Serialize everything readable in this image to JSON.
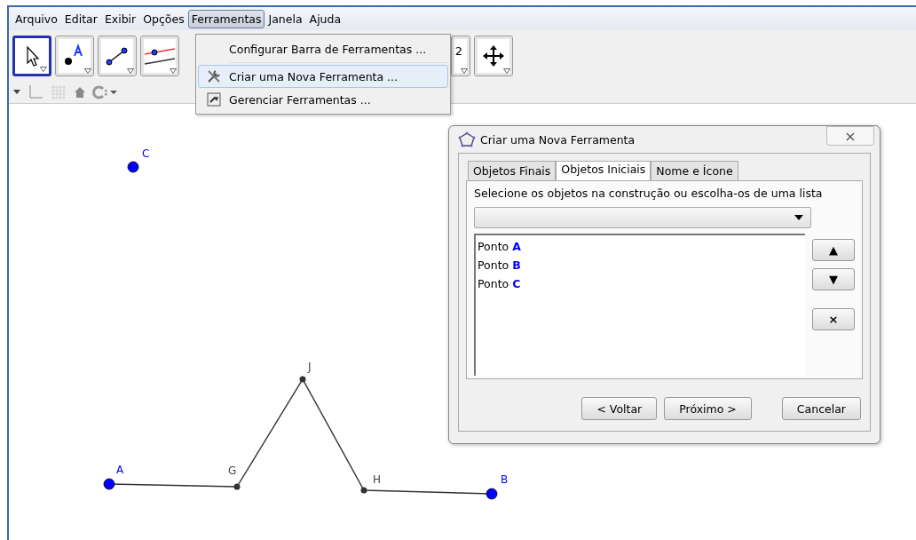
{
  "menu_bar": [
    {
      "label": "Arquivo",
      "selected": false
    },
    {
      "label": "Editar",
      "selected": false
    },
    {
      "label": "Exibir",
      "selected": false
    },
    {
      "label": "Opções",
      "selected": false
    },
    {
      "label": "Ferramentas",
      "selected": true
    },
    {
      "label": "Janela",
      "selected": false
    },
    {
      "label": "Ajuda",
      "selected": false
    }
  ],
  "toolbar": [
    {
      "kind": "select",
      "selected": true
    },
    {
      "kind": "point",
      "selected": false
    },
    {
      "kind": "segment",
      "selected": false
    },
    {
      "kind": "parallel",
      "selected": false
    },
    {
      "kind": "slider",
      "label": "2",
      "selected": false
    },
    {
      "kind": "move",
      "selected": false
    }
  ],
  "dropdown_menu": [
    {
      "kind": "plain",
      "label": "Configurar Barra de Ferramentas ...",
      "selected": false
    },
    {
      "kind": "create",
      "label": "Criar uma Nova Ferramenta ...",
      "selected": true
    },
    {
      "kind": "manage",
      "label": "Gerenciar Ferramentas ...",
      "selected": false
    }
  ],
  "canvas": {
    "points": [
      {
        "label": "C",
        "kind": "free"
      },
      {
        "label": "A",
        "kind": "free"
      },
      {
        "label": "G",
        "kind": "dependent"
      },
      {
        "label": "J",
        "kind": "dependent"
      },
      {
        "label": "H",
        "kind": "dependent"
      },
      {
        "label": "B",
        "kind": "free"
      }
    ]
  },
  "dialog": {
    "title": "Criar uma Nova Ferramenta",
    "close": "×",
    "tabs": [
      {
        "label": "Objetos Finais",
        "selected": false
      },
      {
        "label": "Objetos Iniciais",
        "selected": true
      },
      {
        "label": "Nome e Ícone",
        "selected": false
      }
    ],
    "instruction": "Selecione os objetos na construção ou escolha-os de uma lista",
    "objects": [
      {
        "type": "Ponto",
        "name": "A"
      },
      {
        "type": "Ponto",
        "name": "B"
      },
      {
        "type": "Ponto",
        "name": "C"
      }
    ],
    "side_buttons": [
      {
        "kind": "up",
        "label": "▲"
      },
      {
        "kind": "down",
        "label": "▼"
      },
      {
        "kind": "remove",
        "label": "×"
      }
    ],
    "buttons": [
      "< Voltar",
      "Próximo >",
      "Cancelar"
    ]
  }
}
